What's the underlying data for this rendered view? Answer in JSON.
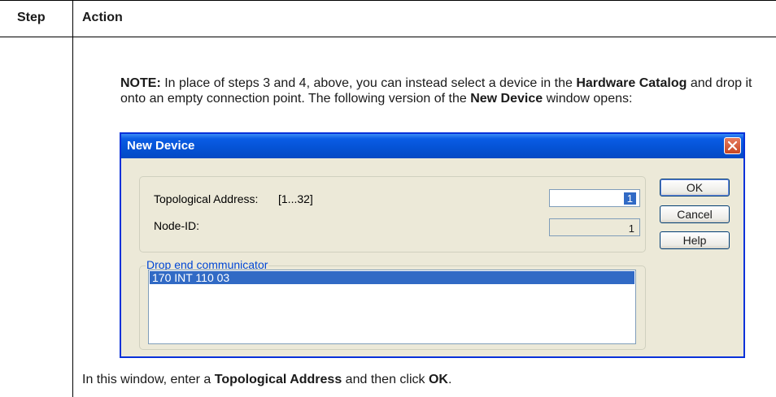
{
  "table": {
    "header_step": "Step",
    "header_action": "Action"
  },
  "note": {
    "label": "NOTE:",
    "text1": " In place of steps 3 and 4, above, you can instead select a device in the ",
    "bold1": "Hardware Catalog",
    "text2": " and drop it onto an empty connection point. The following version of the ",
    "bold2": "New Device",
    "text3": " window opens:"
  },
  "dialog": {
    "title": "New Device",
    "topological_label": "Topological Address:",
    "topological_range": "[1...32]",
    "topological_value": "1",
    "node_id_label": "Node-ID:",
    "node_id_value": "1",
    "ok_label": "OK",
    "cancel_label": "Cancel",
    "help_label": "Help",
    "group_label": "Drop end communicator",
    "list_items": [
      "170 INT 110 03"
    ]
  },
  "footer": {
    "text1": "In this window, enter a ",
    "bold1": "Topological Address",
    "text2": " and then click ",
    "bold2": "OK",
    "text3": "."
  },
  "colors": {
    "title_bar": "#0553d6",
    "selection": "#316ac5",
    "dialog_bg": "#ece9d8",
    "group_label": "#0046d5"
  }
}
